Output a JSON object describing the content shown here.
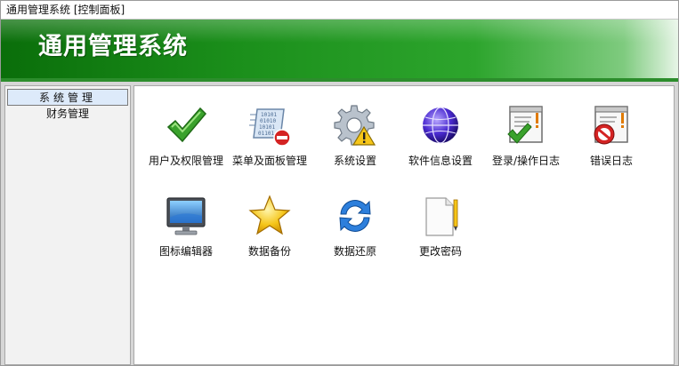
{
  "window": {
    "title": "通用管理系统 [控制面板]"
  },
  "banner": {
    "app_title": "通用管理系统"
  },
  "sidebar": {
    "items": [
      {
        "label": "系统管理",
        "active": true
      },
      {
        "label": "财务管理",
        "active": false
      }
    ]
  },
  "tiles": [
    {
      "label": "用户及权限管理",
      "icon": "checkmark-icon"
    },
    {
      "label": "菜单及面板管理",
      "icon": "binary-document-no-entry-icon"
    },
    {
      "label": "系统设置",
      "icon": "gear-warning-icon"
    },
    {
      "label": "软件信息设置",
      "icon": "globe-icon"
    },
    {
      "label": "登录/操作日志",
      "icon": "log-window-check-icon"
    },
    {
      "label": "错误日志",
      "icon": "log-window-error-icon"
    },
    {
      "label": "图标编辑器",
      "icon": "monitor-icon"
    },
    {
      "label": "数据备份",
      "icon": "star-icon"
    },
    {
      "label": "数据还原",
      "icon": "refresh-arrows-icon"
    },
    {
      "label": "更改密码",
      "icon": "document-pencil-icon"
    }
  ],
  "colors": {
    "banner_green": "#1b8f1b",
    "check_green": "#3aa22c",
    "error_red": "#d42323"
  }
}
